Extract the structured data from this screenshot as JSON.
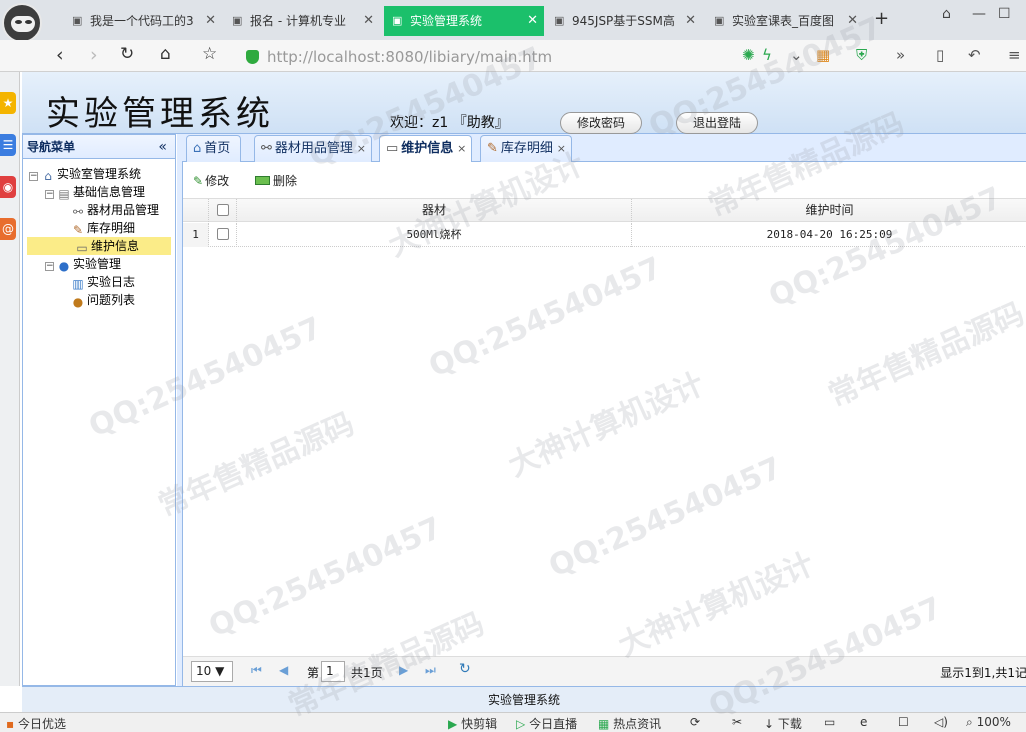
{
  "browser": {
    "tabs": [
      {
        "label": "我是一个代码工的3",
        "active": false
      },
      {
        "label": "报名 - 计算机专业",
        "active": false
      },
      {
        "label": "实验管理系统",
        "active": true
      },
      {
        "label": "945JSP基于SSM高",
        "active": false
      },
      {
        "label": "实验室课表_百度图",
        "active": false
      }
    ],
    "url_host": "http://localhost",
    "url_path": ":8080/libiary/main.htm"
  },
  "header": {
    "title": "实验管理系统",
    "welcome": "欢迎：z1 『助教』",
    "change_password": "修改密码",
    "logout": "退出登陆"
  },
  "menu": {
    "title": "导航菜单",
    "collapse": "«",
    "root": "实验室管理系统",
    "group1": "基础信息管理",
    "item1": "器材用品管理",
    "item2": "库存明细",
    "item3": "维护信息",
    "group2": "实验管理",
    "item4": "实验日志",
    "item5": "问题列表"
  },
  "content_tabs": {
    "home": "首页",
    "equipment": "器材用品管理",
    "maintenance": "维护信息",
    "inventory": "库存明细",
    "close": "×"
  },
  "toolbar": {
    "edit": "修改",
    "delete": "删除"
  },
  "grid": {
    "columns": [
      "器材",
      "维护时间"
    ],
    "rows": [
      {
        "num": "1",
        "equipment": "500Ml烧杯",
        "time": "2018-04-20 16:25:09"
      }
    ]
  },
  "pager": {
    "page_size": "10 ▼",
    "page_prefix": "第",
    "page_value": "1",
    "page_suffix": "共1页",
    "info": "显示1到1,共1记"
  },
  "footer": {
    "text": "实验管理系统"
  },
  "statusbar": {
    "left": "今日优选",
    "items": [
      "快剪辑",
      "今日直播",
      "热点资讯",
      "下载",
      "100%"
    ]
  },
  "watermarks": [
    "QQ:254540457",
    "常年售精品源码",
    "大神计算机设计"
  ]
}
